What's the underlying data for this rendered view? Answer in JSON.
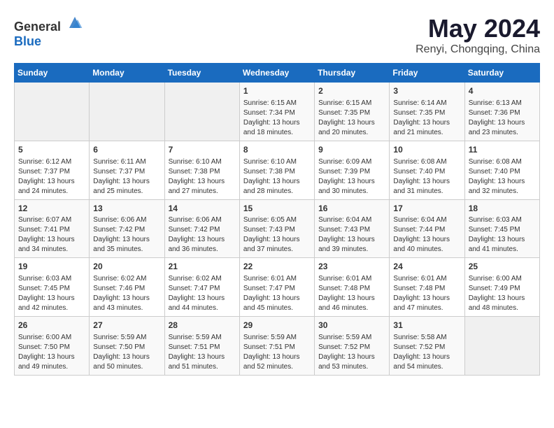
{
  "logo": {
    "text_general": "General",
    "text_blue": "Blue"
  },
  "title": "May 2024",
  "subtitle": "Renyi, Chongqing, China",
  "days_of_week": [
    "Sunday",
    "Monday",
    "Tuesday",
    "Wednesday",
    "Thursday",
    "Friday",
    "Saturday"
  ],
  "weeks": [
    [
      {
        "day": "",
        "info": ""
      },
      {
        "day": "",
        "info": ""
      },
      {
        "day": "",
        "info": ""
      },
      {
        "day": "1",
        "info": "Sunrise: 6:15 AM\nSunset: 7:34 PM\nDaylight: 13 hours\nand 18 minutes."
      },
      {
        "day": "2",
        "info": "Sunrise: 6:15 AM\nSunset: 7:35 PM\nDaylight: 13 hours\nand 20 minutes."
      },
      {
        "day": "3",
        "info": "Sunrise: 6:14 AM\nSunset: 7:35 PM\nDaylight: 13 hours\nand 21 minutes."
      },
      {
        "day": "4",
        "info": "Sunrise: 6:13 AM\nSunset: 7:36 PM\nDaylight: 13 hours\nand 23 minutes."
      }
    ],
    [
      {
        "day": "5",
        "info": "Sunrise: 6:12 AM\nSunset: 7:37 PM\nDaylight: 13 hours\nand 24 minutes."
      },
      {
        "day": "6",
        "info": "Sunrise: 6:11 AM\nSunset: 7:37 PM\nDaylight: 13 hours\nand 25 minutes."
      },
      {
        "day": "7",
        "info": "Sunrise: 6:10 AM\nSunset: 7:38 PM\nDaylight: 13 hours\nand 27 minutes."
      },
      {
        "day": "8",
        "info": "Sunrise: 6:10 AM\nSunset: 7:38 PM\nDaylight: 13 hours\nand 28 minutes."
      },
      {
        "day": "9",
        "info": "Sunrise: 6:09 AM\nSunset: 7:39 PM\nDaylight: 13 hours\nand 30 minutes."
      },
      {
        "day": "10",
        "info": "Sunrise: 6:08 AM\nSunset: 7:40 PM\nDaylight: 13 hours\nand 31 minutes."
      },
      {
        "day": "11",
        "info": "Sunrise: 6:08 AM\nSunset: 7:40 PM\nDaylight: 13 hours\nand 32 minutes."
      }
    ],
    [
      {
        "day": "12",
        "info": "Sunrise: 6:07 AM\nSunset: 7:41 PM\nDaylight: 13 hours\nand 34 minutes."
      },
      {
        "day": "13",
        "info": "Sunrise: 6:06 AM\nSunset: 7:42 PM\nDaylight: 13 hours\nand 35 minutes."
      },
      {
        "day": "14",
        "info": "Sunrise: 6:06 AM\nSunset: 7:42 PM\nDaylight: 13 hours\nand 36 minutes."
      },
      {
        "day": "15",
        "info": "Sunrise: 6:05 AM\nSunset: 7:43 PM\nDaylight: 13 hours\nand 37 minutes."
      },
      {
        "day": "16",
        "info": "Sunrise: 6:04 AM\nSunset: 7:43 PM\nDaylight: 13 hours\nand 39 minutes."
      },
      {
        "day": "17",
        "info": "Sunrise: 6:04 AM\nSunset: 7:44 PM\nDaylight: 13 hours\nand 40 minutes."
      },
      {
        "day": "18",
        "info": "Sunrise: 6:03 AM\nSunset: 7:45 PM\nDaylight: 13 hours\nand 41 minutes."
      }
    ],
    [
      {
        "day": "19",
        "info": "Sunrise: 6:03 AM\nSunset: 7:45 PM\nDaylight: 13 hours\nand 42 minutes."
      },
      {
        "day": "20",
        "info": "Sunrise: 6:02 AM\nSunset: 7:46 PM\nDaylight: 13 hours\nand 43 minutes."
      },
      {
        "day": "21",
        "info": "Sunrise: 6:02 AM\nSunset: 7:47 PM\nDaylight: 13 hours\nand 44 minutes."
      },
      {
        "day": "22",
        "info": "Sunrise: 6:01 AM\nSunset: 7:47 PM\nDaylight: 13 hours\nand 45 minutes."
      },
      {
        "day": "23",
        "info": "Sunrise: 6:01 AM\nSunset: 7:48 PM\nDaylight: 13 hours\nand 46 minutes."
      },
      {
        "day": "24",
        "info": "Sunrise: 6:01 AM\nSunset: 7:48 PM\nDaylight: 13 hours\nand 47 minutes."
      },
      {
        "day": "25",
        "info": "Sunrise: 6:00 AM\nSunset: 7:49 PM\nDaylight: 13 hours\nand 48 minutes."
      }
    ],
    [
      {
        "day": "26",
        "info": "Sunrise: 6:00 AM\nSunset: 7:50 PM\nDaylight: 13 hours\nand 49 minutes."
      },
      {
        "day": "27",
        "info": "Sunrise: 5:59 AM\nSunset: 7:50 PM\nDaylight: 13 hours\nand 50 minutes."
      },
      {
        "day": "28",
        "info": "Sunrise: 5:59 AM\nSunset: 7:51 PM\nDaylight: 13 hours\nand 51 minutes."
      },
      {
        "day": "29",
        "info": "Sunrise: 5:59 AM\nSunset: 7:51 PM\nDaylight: 13 hours\nand 52 minutes."
      },
      {
        "day": "30",
        "info": "Sunrise: 5:59 AM\nSunset: 7:52 PM\nDaylight: 13 hours\nand 53 minutes."
      },
      {
        "day": "31",
        "info": "Sunrise: 5:58 AM\nSunset: 7:52 PM\nDaylight: 13 hours\nand 54 minutes."
      },
      {
        "day": "",
        "info": ""
      }
    ]
  ]
}
